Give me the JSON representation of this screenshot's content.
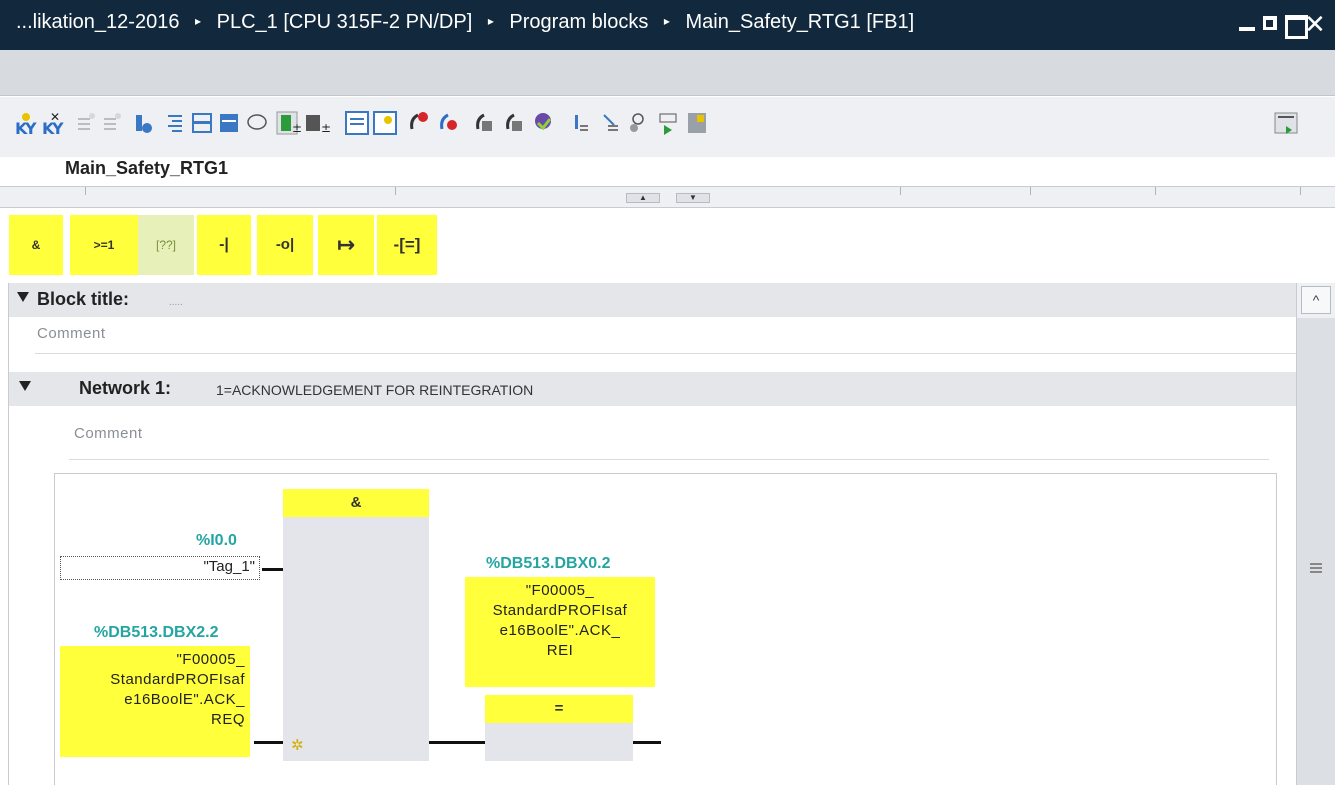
{
  "titlebar": {
    "crumbs": [
      "...likation_12-2016",
      "PLC_1 [CPU 315F-2 PN/DP]",
      "Program blocks",
      "Main_Safety_RTG1 [FB1]"
    ],
    "separator": "▸",
    "close": "✕"
  },
  "block_name": "Main_Safety_RTG1",
  "toolbar": {
    "icons": [
      "insert-network-icon",
      "delete-network-icon",
      "insert-row-icon",
      "append-row-icon",
      "interface-icon",
      "show-all-icon",
      "close-all-icon",
      "absolute-operand-icon",
      "comment-icon",
      "favorites-icon",
      "instructions-icon",
      "list-icon",
      "breakpoint-icon",
      "delete-breakpoint-icon",
      "monitor-icon",
      "monitor-all-icon",
      "next-icon",
      "step-in-icon",
      "step-out-icon",
      "link-icon",
      "download-icon",
      "compare-icon",
      "page-icon"
    ]
  },
  "ruler": {
    "up": "▲",
    "down": "▼"
  },
  "favorites": [
    {
      "label": "&",
      "name": "and-fav"
    },
    {
      "label": ">=1",
      "name": "or-fav"
    },
    {
      "label": "[??]",
      "name": "empty-box-fav"
    },
    {
      "label": "-|",
      "name": "no-contact-fav"
    },
    {
      "label": "-o|",
      "name": "nc-contact-fav"
    },
    {
      "label": "↦",
      "name": "branch-fav"
    },
    {
      "label": "-[=]",
      "name": "assignment-fav"
    }
  ],
  "block_title": {
    "label": "Block title:",
    "value": ".....",
    "comment": "Comment"
  },
  "network": {
    "label": "Network 1:",
    "title": "1=ACKNOWLEDGEMENT FOR REINTEGRATION",
    "comment": "Comment",
    "and_block": "&",
    "assign_block": "=",
    "input1_addr": "%I0.0",
    "input1_tag": "\"Tag_1\"",
    "input2_addr": "%DB513.DBX2.2",
    "input2_lines": [
      "\"F00005_",
      "StandardPROFIsaf",
      "e16BoolE\".ACK_",
      "REQ"
    ],
    "output_addr": "%DB513.DBX0.2",
    "output_lines": [
      "\"F00005_",
      "StandardPROFIsaf",
      "e16BoolE\".ACK_",
      "REI"
    ],
    "pin_marker": "✲"
  },
  "scrollbar": {
    "up": "^"
  }
}
